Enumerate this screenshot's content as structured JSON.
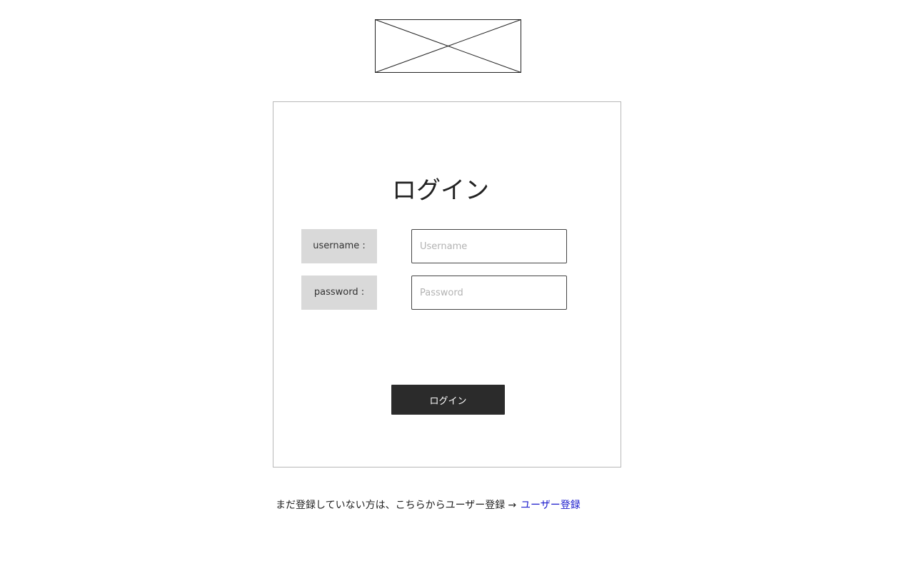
{
  "header": {
    "logo_icon": "image-placeholder-icon"
  },
  "login_card": {
    "title": "ログイン",
    "username": {
      "label": "username :",
      "value": "",
      "placeholder": "Username"
    },
    "password": {
      "label": "password :",
      "value": "",
      "placeholder": "Password"
    },
    "submit_label": "ログイン"
  },
  "footer": {
    "register_prompt": "まだ登録していない方は、こちらからユーザー登録",
    "arrow": "→",
    "register_link_label": "ユーザー登録"
  },
  "colors": {
    "button_bg": "#2b2b2b",
    "label_bg": "#d9d9d9",
    "link": "#1a1acc",
    "card_border": "#b8b8b8"
  }
}
